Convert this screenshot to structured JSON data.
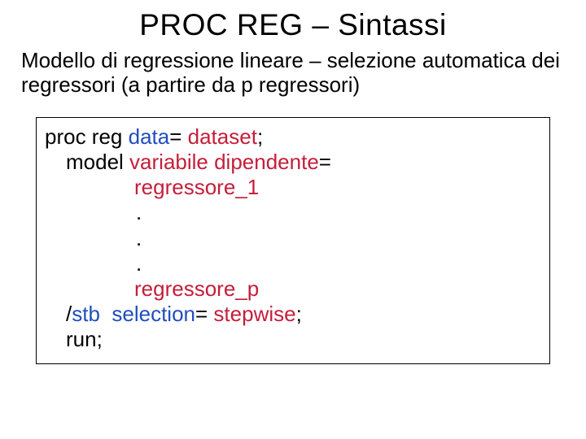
{
  "title": "PROC REG – Sintassi",
  "subtitle": "Modello di regressione lineare – selezione automatica dei regressori (a partire da p regressori)",
  "code": {
    "l1a": "proc reg ",
    "l1b": "data",
    "l1c": "= ",
    "l1d": "dataset",
    "l1e": ";",
    "l2a": "model ",
    "l2b": "variabile dipendente",
    "l2c": "=",
    "l3": "regressore_1",
    "dot": ".",
    "l5": "regressore_p",
    "l6a": "/",
    "l6b": "stb  ",
    "l6c": "selection",
    "l6d": "= ",
    "l6e": "stepwise",
    "l6f": ";",
    "l7a": "run",
    "l7b": ";"
  }
}
